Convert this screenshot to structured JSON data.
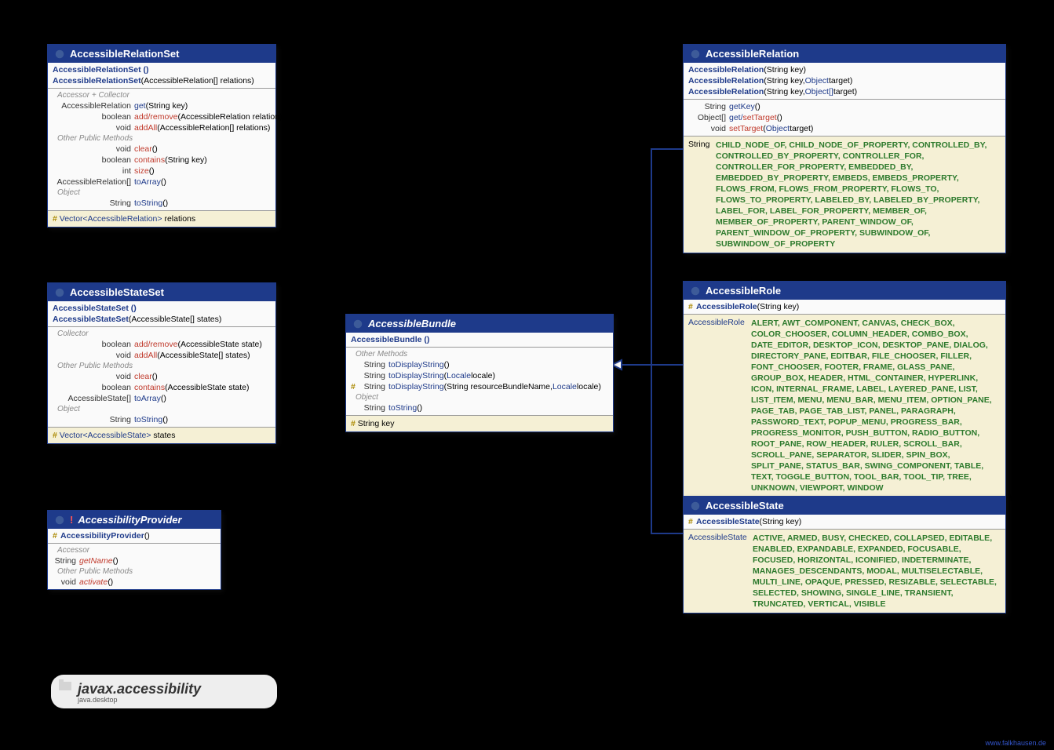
{
  "package": {
    "name": "javax.accessibility",
    "module": "java.desktop"
  },
  "watermark": "www.falkhausen.de",
  "boxes": {
    "relationSet": {
      "title": "AccessibleRelationSet",
      "ctors": [
        {
          "sig": "AccessibleRelationSet ()"
        },
        {
          "sig": "AccessibleRelationSet (AccessibleRelation[] relations)",
          "params": " (AccessibleRelation[] relations)",
          "name": "AccessibleRelationSet"
        }
      ],
      "section1_label": "Accessor + Collector",
      "section1": [
        {
          "type": "AccessibleRelation",
          "name": "get",
          "params": " (String key)"
        },
        {
          "type": "boolean",
          "name": "add/remove",
          "accent": "red",
          "params": " (AccessibleRelation relation)"
        },
        {
          "type": "void",
          "name": "addAll",
          "accent": "red",
          "params": " (AccessibleRelation[] relations)"
        }
      ],
      "section2_label": "Other Public Methods",
      "section2": [
        {
          "type": "void",
          "name": "clear",
          "accent": "red",
          "params": " ()"
        },
        {
          "type": "boolean",
          "name": "contains",
          "accent": "red",
          "params": " (String key)"
        },
        {
          "type": "int",
          "name": "size",
          "accent": "red",
          "params": " ()"
        },
        {
          "type": "AccessibleRelation[]",
          "name": "toArray",
          "params": " ()"
        }
      ],
      "section3_label": "Object",
      "section3": [
        {
          "type": "String",
          "name": "toString",
          "params": " ()"
        }
      ],
      "footer": {
        "vis": "#",
        "type": "Vector",
        "generic": "<AccessibleRelation>",
        "name": " relations"
      }
    },
    "stateSet": {
      "title": "AccessibleStateSet",
      "ctors": [
        {
          "sig": "AccessibleStateSet ()"
        },
        {
          "name": "AccessibleStateSet",
          "params": " (AccessibleState[] states)"
        }
      ],
      "section1_label": "Collector",
      "section1": [
        {
          "type": "boolean",
          "name": "add/remove",
          "accent": "red",
          "params": " (AccessibleState state)"
        },
        {
          "type": "void",
          "name": "addAll",
          "accent": "red",
          "params": " (AccessibleState[] states)"
        }
      ],
      "section2_label": "Other Public Methods",
      "section2": [
        {
          "type": "void",
          "name": "clear",
          "accent": "red",
          "params": " ()"
        },
        {
          "type": "boolean",
          "name": "contains",
          "accent": "red",
          "params": " (AccessibleState state)"
        },
        {
          "type": "AccessibleState[]",
          "name": "toArray",
          "params": " ()"
        }
      ],
      "section3_label": "Object",
      "section3": [
        {
          "type": "String",
          "name": "toString",
          "params": " ()"
        }
      ],
      "footer": {
        "vis": "#",
        "type": "Vector",
        "generic": "<AccessibleState>",
        "name": " states"
      }
    },
    "provider": {
      "title": "AccessibilityProvider",
      "abstract": true,
      "ctors": [
        {
          "vis": "#",
          "name": "AccessibilityProvider",
          "params": " ()"
        }
      ],
      "section1_label": "Accessor",
      "section1": [
        {
          "type": "String",
          "name": "getName",
          "accent": "red",
          "italic": true,
          "params": " ()"
        }
      ],
      "section2_label": "Other Public Methods",
      "section2": [
        {
          "type": "void",
          "name": "activate",
          "accent": "red",
          "italic": true,
          "params": " ()"
        }
      ]
    },
    "bundle": {
      "title": "AccessibleBundle",
      "ctors": [
        {
          "sig": "AccessibleBundle ()"
        }
      ],
      "section1_label": "Other Methods",
      "section1": [
        {
          "type": "String",
          "name": "toDisplayString",
          "params": " ()"
        },
        {
          "type": "String",
          "name": "toDisplayString",
          "params_pre": " (",
          "param1": "Locale",
          "param1_rest": " locale)"
        },
        {
          "vis": "#",
          "type": "String",
          "name": "toDisplayString",
          "params_pre": " (String resourceBundleName, ",
          "param1": "Locale",
          "param1_rest": " locale)"
        }
      ],
      "section2_label": "Object",
      "section2": [
        {
          "type": "String",
          "name": "toString",
          "params": " ()"
        }
      ],
      "footer": {
        "vis": "#",
        "text": "String  key"
      }
    },
    "relation": {
      "title": "AccessibleRelation",
      "ctors": [
        {
          "name": "AccessibleRelation",
          "params": " (String key)"
        },
        {
          "name": "AccessibleRelation",
          "params_pre": " (String key, ",
          "p": "Object",
          "after": " target)"
        },
        {
          "name": "AccessibleRelation",
          "params_pre": " (String key, ",
          "p": "Object[]",
          "after": " target)"
        }
      ],
      "methods": [
        {
          "type": "String",
          "name": "getKey",
          "params": " ()"
        },
        {
          "type": "Object[]",
          "name_pre": "get/",
          "name_red": "setTarget",
          "params": " ()"
        },
        {
          "type": "void",
          "name": "setTarget",
          "accent": "red",
          "params_pre": " (",
          "p": "Object",
          "after": " target)"
        }
      ],
      "consts_type": "String",
      "consts": "CHILD_NODE_OF, CHILD_NODE_OF_PROPERTY, CONTROLLED_BY, CONTROLLED_BY_PROPERTY, CONTROLLER_FOR, CONTROLLER_FOR_PROPERTY, EMBEDDED_BY, EMBEDDED_BY_PROPERTY, EMBEDS, EMBEDS_PROPERTY, FLOWS_FROM, FLOWS_FROM_PROPERTY, FLOWS_TO, FLOWS_TO_PROPERTY, LABELED_BY, LABELED_BY_PROPERTY, LABEL_FOR, LABEL_FOR_PROPERTY, MEMBER_OF, MEMBER_OF_PROPERTY, PARENT_WINDOW_OF, PARENT_WINDOW_OF_PROPERTY, SUBWINDOW_OF, SUBWINDOW_OF_PROPERTY"
    },
    "role": {
      "title": "AccessibleRole",
      "ctor": {
        "vis": "#",
        "name": "AccessibleRole",
        "params": " (String key)"
      },
      "consts_type": "AccessibleRole",
      "consts": "ALERT, AWT_COMPONENT, CANVAS, CHECK_BOX, COLOR_CHOOSER, COLUMN_HEADER, COMBO_BOX, DATE_EDITOR, DESKTOP_ICON, DESKTOP_PANE, DIALOG, DIRECTORY_PANE, EDITBAR, FILE_CHOOSER, FILLER, FONT_CHOOSER, FOOTER, FRAME, GLASS_PANE, GROUP_BOX, HEADER, HTML_CONTAINER, HYPERLINK, ICON, INTERNAL_FRAME, LABEL, LAYERED_PANE, LIST, LIST_ITEM, MENU, MENU_BAR, MENU_ITEM, OPTION_PANE, PAGE_TAB, PAGE_TAB_LIST, PANEL, PARAGRAPH, PASSWORD_TEXT, POPUP_MENU, PROGRESS_BAR, PROGRESS_MONITOR, PUSH_BUTTON, RADIO_BUTTON, ROOT_PANE, ROW_HEADER, RULER, SCROLL_BAR, SCROLL_PANE, SEPARATOR, SLIDER, SPIN_BOX, SPLIT_PANE, STATUS_BAR, SWING_COMPONENT, TABLE, TEXT, TOGGLE_BUTTON, TOOL_BAR, TOOL_TIP, TREE, UNKNOWN, VIEWPORT, WINDOW"
    },
    "state": {
      "title": "AccessibleState",
      "ctor": {
        "vis": "#",
        "name": "AccessibleState",
        "params": " (String key)"
      },
      "consts_type": "AccessibleState",
      "consts": "ACTIVE, ARMED, BUSY, CHECKED, COLLAPSED, EDITABLE, ENABLED, EXPANDABLE, EXPANDED, FOCUSABLE, FOCUSED, HORIZONTAL, ICONIFIED, INDETERMINATE, MANAGES_DESCENDANTS, MODAL, MULTISELECTABLE, MULTI_LINE, OPAQUE, PRESSED, RESIZABLE, SELECTABLE, SELECTED, SHOWING, SINGLE_LINE, TRANSIENT, TRUNCATED, VERTICAL, VISIBLE"
    }
  }
}
